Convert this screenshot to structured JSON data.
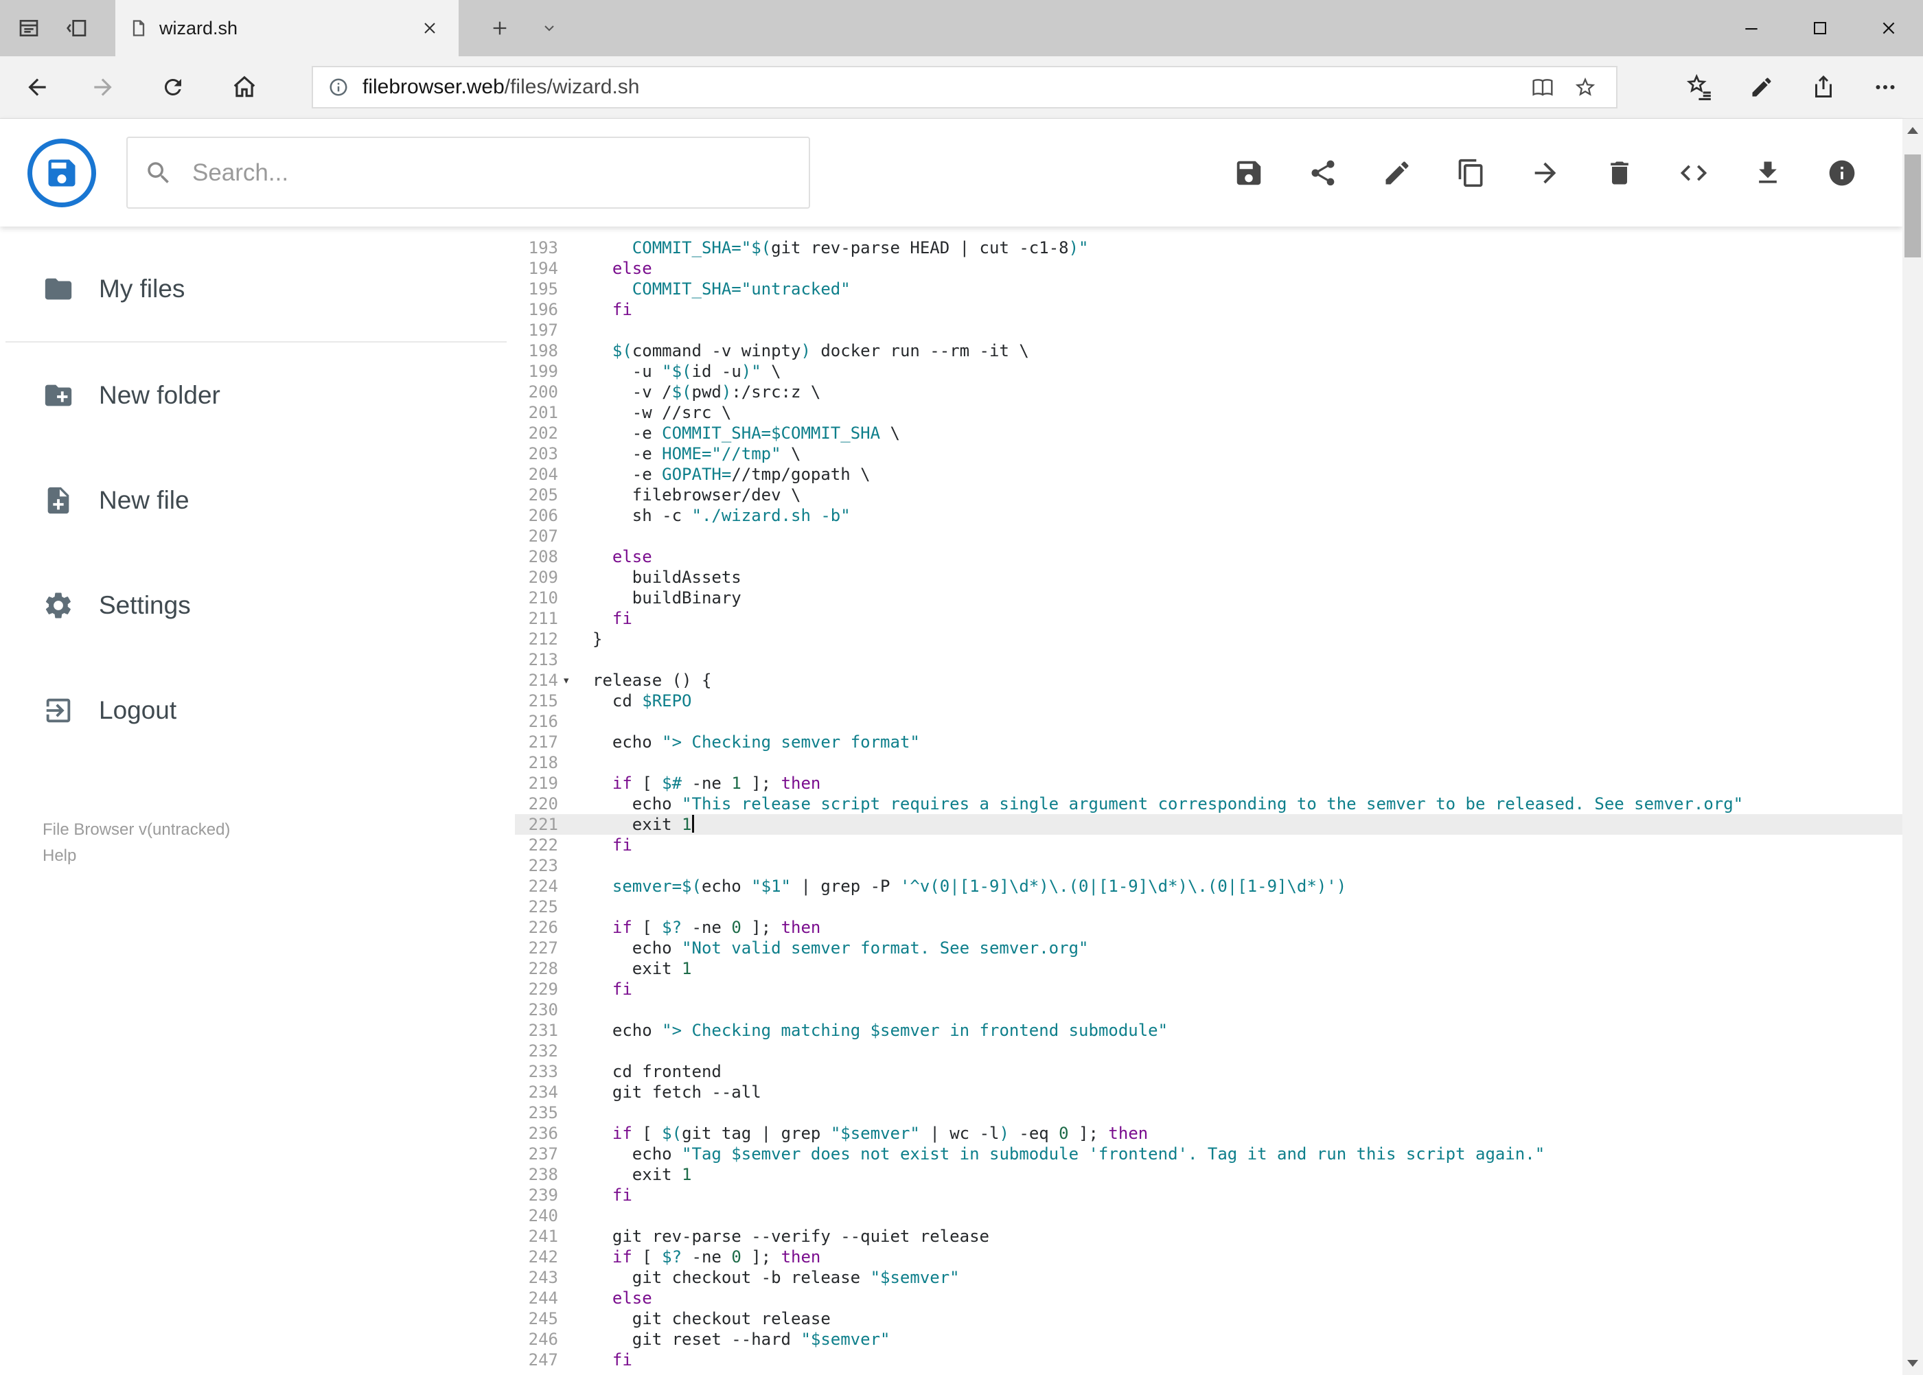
{
  "browser": {
    "tab": {
      "title": "wizard.sh"
    },
    "url": {
      "domain": "filebrowser.web",
      "path": "/files/wizard.sh"
    }
  },
  "toolbar": {
    "search_placeholder": "Search...",
    "action_icons": [
      "save",
      "share",
      "edit",
      "copy",
      "move",
      "delete",
      "code",
      "download",
      "info"
    ]
  },
  "sidebar": {
    "items": [
      {
        "label": "My files"
      },
      {
        "label": "New folder"
      },
      {
        "label": "New file"
      },
      {
        "label": "Settings"
      },
      {
        "label": "Logout"
      }
    ],
    "footer": {
      "version": "File Browser v(untracked)",
      "help": "Help"
    }
  },
  "editor": {
    "active_line": 221,
    "first_line": 193,
    "lines": [
      {
        "n": 193,
        "t": [
          [
            "p",
            "    "
          ],
          [
            "v",
            "COMMIT_SHA="
          ],
          [
            "s",
            "\"$("
          ],
          [
            "p",
            "git rev-parse HEAD | cut -c1-8"
          ],
          [
            "s",
            ")\""
          ]
        ]
      },
      {
        "n": 194,
        "t": [
          [
            "p",
            "  "
          ],
          [
            "k",
            "else"
          ]
        ]
      },
      {
        "n": 195,
        "t": [
          [
            "p",
            "    "
          ],
          [
            "v",
            "COMMIT_SHA="
          ],
          [
            "s",
            "\"untracked\""
          ]
        ]
      },
      {
        "n": 196,
        "t": [
          [
            "p",
            "  "
          ],
          [
            "k",
            "fi"
          ]
        ]
      },
      {
        "n": 197,
        "t": []
      },
      {
        "n": 198,
        "t": [
          [
            "p",
            "  "
          ],
          [
            "v",
            "$("
          ],
          [
            "p",
            "command -v winpty"
          ],
          [
            "v",
            ")"
          ],
          [
            "p",
            " docker run --rm -it \\"
          ]
        ]
      },
      {
        "n": 199,
        "t": [
          [
            "p",
            "    -u "
          ],
          [
            "s",
            "\"$("
          ],
          [
            "p",
            "id -u"
          ],
          [
            "s",
            ")\""
          ],
          [
            "p",
            " \\"
          ]
        ]
      },
      {
        "n": 200,
        "t": [
          [
            "p",
            "    -v /"
          ],
          [
            "v",
            "$("
          ],
          [
            "p",
            "pwd"
          ],
          [
            "v",
            ")"
          ],
          [
            "p",
            ":/src:z \\"
          ]
        ]
      },
      {
        "n": 201,
        "t": [
          [
            "p",
            "    -w //src \\"
          ]
        ]
      },
      {
        "n": 202,
        "t": [
          [
            "p",
            "    -e "
          ],
          [
            "v",
            "COMMIT_SHA=$COMMIT_SHA"
          ],
          [
            "p",
            " \\"
          ]
        ]
      },
      {
        "n": 203,
        "t": [
          [
            "p",
            "    -e "
          ],
          [
            "v",
            "HOME="
          ],
          [
            "s",
            "\"//tmp\""
          ],
          [
            "p",
            " \\"
          ]
        ]
      },
      {
        "n": 204,
        "t": [
          [
            "p",
            "    -e "
          ],
          [
            "v",
            "GOPATH="
          ],
          [
            "p",
            "//tmp/gopath \\"
          ]
        ]
      },
      {
        "n": 205,
        "t": [
          [
            "p",
            "    filebrowser/dev \\"
          ]
        ]
      },
      {
        "n": 206,
        "t": [
          [
            "p",
            "    sh -c "
          ],
          [
            "s",
            "\"./wizard.sh -b\""
          ]
        ]
      },
      {
        "n": 207,
        "t": []
      },
      {
        "n": 208,
        "t": [
          [
            "p",
            "  "
          ],
          [
            "k",
            "else"
          ]
        ]
      },
      {
        "n": 209,
        "t": [
          [
            "p",
            "    buildAssets"
          ]
        ]
      },
      {
        "n": 210,
        "t": [
          [
            "p",
            "    buildBinary"
          ]
        ]
      },
      {
        "n": 211,
        "t": [
          [
            "p",
            "  "
          ],
          [
            "k",
            "fi"
          ]
        ]
      },
      {
        "n": 212,
        "t": [
          [
            "p",
            "}"
          ]
        ]
      },
      {
        "n": 213,
        "t": []
      },
      {
        "n": 214,
        "fold": true,
        "t": [
          [
            "p",
            "release () {"
          ]
        ]
      },
      {
        "n": 215,
        "t": [
          [
            "p",
            "  cd "
          ],
          [
            "v",
            "$REPO"
          ]
        ]
      },
      {
        "n": 216,
        "t": []
      },
      {
        "n": 217,
        "t": [
          [
            "p",
            "  echo "
          ],
          [
            "s",
            "\"> Checking semver format\""
          ]
        ]
      },
      {
        "n": 218,
        "t": []
      },
      {
        "n": 219,
        "t": [
          [
            "p",
            "  "
          ],
          [
            "k",
            "if"
          ],
          [
            "p",
            " [ "
          ],
          [
            "v",
            "$#"
          ],
          [
            "p",
            " -ne "
          ],
          [
            "d",
            "1"
          ],
          [
            "p",
            " ]; "
          ],
          [
            "k",
            "then"
          ]
        ]
      },
      {
        "n": 220,
        "t": [
          [
            "p",
            "    echo "
          ],
          [
            "s",
            "\"This release script requires a single argument corresponding to the semver to be released. See semver.org\""
          ]
        ]
      },
      {
        "n": 221,
        "cursor": true,
        "t": [
          [
            "p",
            "    exit "
          ],
          [
            "d",
            "1"
          ]
        ]
      },
      {
        "n": 222,
        "t": [
          [
            "p",
            "  "
          ],
          [
            "k",
            "fi"
          ]
        ]
      },
      {
        "n": 223,
        "t": []
      },
      {
        "n": 224,
        "t": [
          [
            "p",
            "  "
          ],
          [
            "v",
            "semver=$("
          ],
          [
            "p",
            "echo "
          ],
          [
            "s",
            "\"$1\""
          ],
          [
            "p",
            " | grep -P "
          ],
          [
            "s",
            "'^v(0|[1-9]\\d*)\\.(0|[1-9]\\d*)\\.(0|[1-9]\\d*)'"
          ],
          [
            "v",
            ")"
          ]
        ]
      },
      {
        "n": 225,
        "t": []
      },
      {
        "n": 226,
        "t": [
          [
            "p",
            "  "
          ],
          [
            "k",
            "if"
          ],
          [
            "p",
            " [ "
          ],
          [
            "v",
            "$?"
          ],
          [
            "p",
            " -ne "
          ],
          [
            "d",
            "0"
          ],
          [
            "p",
            " ]; "
          ],
          [
            "k",
            "then"
          ]
        ]
      },
      {
        "n": 227,
        "t": [
          [
            "p",
            "    echo "
          ],
          [
            "s",
            "\"Not valid semver format. See semver.org\""
          ]
        ]
      },
      {
        "n": 228,
        "t": [
          [
            "p",
            "    exit "
          ],
          [
            "d",
            "1"
          ]
        ]
      },
      {
        "n": 229,
        "t": [
          [
            "p",
            "  "
          ],
          [
            "k",
            "fi"
          ]
        ]
      },
      {
        "n": 230,
        "t": []
      },
      {
        "n": 231,
        "t": [
          [
            "p",
            "  echo "
          ],
          [
            "s",
            "\"> Checking matching "
          ],
          [
            "v",
            "$semver"
          ],
          [
            "s",
            " in frontend submodule\""
          ]
        ]
      },
      {
        "n": 232,
        "t": []
      },
      {
        "n": 233,
        "t": [
          [
            "p",
            "  cd frontend"
          ]
        ]
      },
      {
        "n": 234,
        "t": [
          [
            "p",
            "  git fetch --all"
          ]
        ]
      },
      {
        "n": 235,
        "t": []
      },
      {
        "n": 236,
        "t": [
          [
            "p",
            "  "
          ],
          [
            "k",
            "if"
          ],
          [
            "p",
            " [ "
          ],
          [
            "v",
            "$("
          ],
          [
            "p",
            "git tag | grep "
          ],
          [
            "s",
            "\"$semver\""
          ],
          [
            "p",
            " | wc -l"
          ],
          [
            "v",
            ")"
          ],
          [
            "p",
            " -eq "
          ],
          [
            "d",
            "0"
          ],
          [
            "p",
            " ]; "
          ],
          [
            "k",
            "then"
          ]
        ]
      },
      {
        "n": 237,
        "t": [
          [
            "p",
            "    echo "
          ],
          [
            "s",
            "\"Tag "
          ],
          [
            "v",
            "$semver"
          ],
          [
            "s",
            " does not exist in submodule 'frontend'. Tag it and run this script again.\""
          ]
        ]
      },
      {
        "n": 238,
        "t": [
          [
            "p",
            "    exit "
          ],
          [
            "d",
            "1"
          ]
        ]
      },
      {
        "n": 239,
        "t": [
          [
            "p",
            "  "
          ],
          [
            "k",
            "fi"
          ]
        ]
      },
      {
        "n": 240,
        "t": []
      },
      {
        "n": 241,
        "t": [
          [
            "p",
            "  git rev-parse --verify --quiet release"
          ]
        ]
      },
      {
        "n": 242,
        "t": [
          [
            "p",
            "  "
          ],
          [
            "k",
            "if"
          ],
          [
            "p",
            " [ "
          ],
          [
            "v",
            "$?"
          ],
          [
            "p",
            " -ne "
          ],
          [
            "d",
            "0"
          ],
          [
            "p",
            " ]; "
          ],
          [
            "k",
            "then"
          ]
        ]
      },
      {
        "n": 243,
        "t": [
          [
            "p",
            "    git checkout -b release "
          ],
          [
            "s",
            "\"$semver\""
          ]
        ]
      },
      {
        "n": 244,
        "t": [
          [
            "p",
            "  "
          ],
          [
            "k",
            "else"
          ]
        ]
      },
      {
        "n": 245,
        "t": [
          [
            "p",
            "    git checkout release"
          ]
        ]
      },
      {
        "n": 246,
        "t": [
          [
            "p",
            "    git reset --hard "
          ],
          [
            "s",
            "\"$semver\""
          ]
        ]
      },
      {
        "n": 247,
        "t": [
          [
            "p",
            "  "
          ],
          [
            "k",
            "fi"
          ]
        ]
      }
    ]
  },
  "colors": {
    "accent": "#1976d2",
    "keyword": "#7a0d8e",
    "string": "#0e7f8b",
    "number": "#1d6b48",
    "line_number": "#9e9e9e",
    "active_line_bg": "#ececec",
    "tab_strip": "#cbcbcb"
  }
}
